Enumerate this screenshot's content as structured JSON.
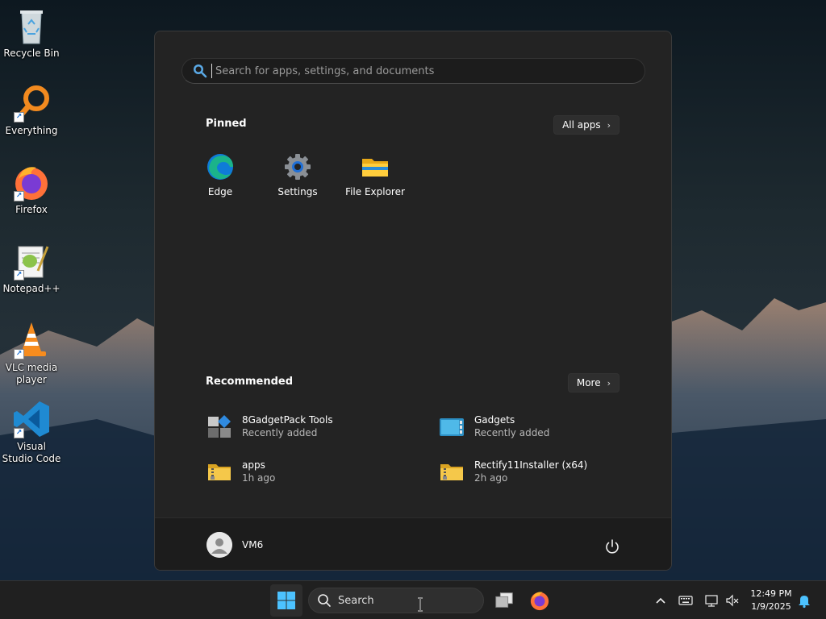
{
  "desktop": {
    "icons": [
      {
        "label": "Recycle Bin",
        "icon": "recycle-bin-icon"
      },
      {
        "label": "Everything",
        "icon": "everything-search-icon"
      },
      {
        "label": "Firefox",
        "icon": "firefox-icon"
      },
      {
        "label": "Notepad++",
        "icon": "notepad-plus-plus-icon"
      },
      {
        "label": "VLC media player",
        "icon": "vlc-cone-icon"
      },
      {
        "label": "Visual Studio Code",
        "icon": "vscode-icon"
      }
    ]
  },
  "start_menu": {
    "search_placeholder": "Search for apps, settings, and documents",
    "pinned": {
      "title": "Pinned",
      "all_apps_label": "All apps",
      "apps": [
        {
          "label": "Edge",
          "icon": "edge-icon"
        },
        {
          "label": "Settings",
          "icon": "settings-gear-icon"
        },
        {
          "label": "File Explorer",
          "icon": "folder-icon"
        }
      ]
    },
    "recommended": {
      "title": "Recommended",
      "more_label": "More",
      "items": [
        {
          "name": "8GadgetPack Tools",
          "sub": "Recently added",
          "icon": "gadgetpack-tools-icon"
        },
        {
          "name": "Gadgets",
          "sub": "Recently added",
          "icon": "gadgets-icon"
        },
        {
          "name": "apps",
          "sub": "1h ago",
          "icon": "zip-folder-icon"
        },
        {
          "name": "Rectify11Installer (x64)",
          "sub": "2h ago",
          "icon": "zip-folder-icon"
        }
      ]
    },
    "user": {
      "name": "VM6"
    }
  },
  "taskbar": {
    "search_label": "Search",
    "time": "12:49 PM",
    "date": "1/9/2025"
  },
  "colors": {
    "start_bg": "#232323",
    "taskbar_bg": "#202020",
    "accent_blue": "#4cc2ff"
  }
}
